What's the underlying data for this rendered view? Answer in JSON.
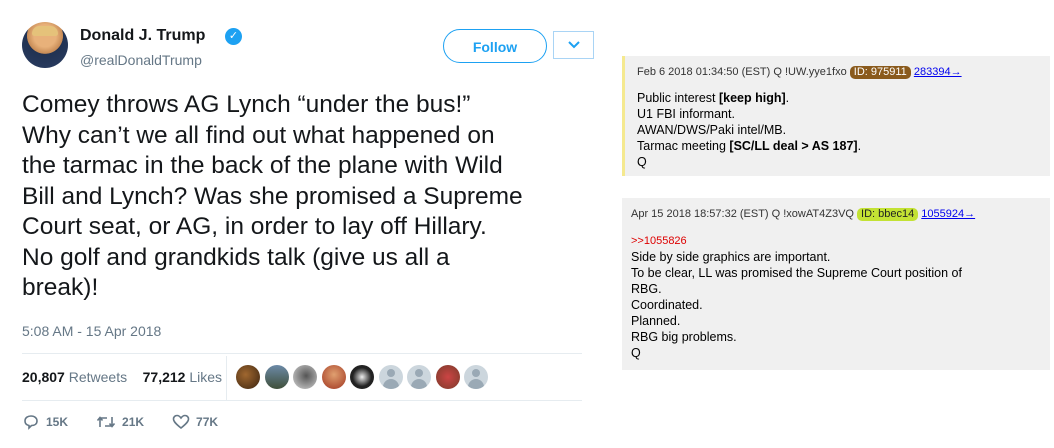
{
  "tweet": {
    "display_name": "Donald J. Trump",
    "handle": "@realDonaldTrump",
    "follow_label": "Follow",
    "text_lines": [
      "Comey throws AG Lynch “under the bus!”",
      "Why can’t we all find out what happened on",
      "the tarmac in the back of the plane with Wild",
      "Bill and Lynch? Was she promised a Supreme",
      "Court seat, or AG, in order to lay off Hillary.",
      "No golf and grandkids talk (give us all a",
      "break)!"
    ],
    "timestamp": "5:08 AM - 15 Apr 2018",
    "retweets_count": "20,807",
    "retweets_label": "Retweets",
    "likes_count": "77,212",
    "likes_label": "Likes",
    "reply_count": "15K",
    "retweet_action_count": "21K",
    "like_action_count": "77K",
    "colors": {
      "accent": "#1da1f2",
      "text": "#14171a",
      "muted": "#657786"
    }
  },
  "qposts": [
    {
      "header": "Feb 6 2018 01:34:50 (EST) Q !UW.yye1fxo",
      "id_label": "ID: 975911",
      "link": "283394→",
      "lines": [
        {
          "text": "Public interest ",
          "bold": "[keep high]",
          "tail": "."
        },
        {
          "text": "U1 FBI informant.",
          "bold": "",
          "tail": ""
        },
        {
          "text": "AWAN/DWS/Paki intel/MB.",
          "bold": "",
          "tail": ""
        },
        {
          "text": "Tarmac meeting ",
          "bold": "[SC/LL deal > AS 187]",
          "tail": "."
        },
        {
          "text": "Q",
          "bold": "",
          "tail": ""
        }
      ]
    },
    {
      "header": "Apr 15 2018 18:57:32 (EST) Q !xowAT4Z3VQ",
      "id_label": "ID: bbec14",
      "link": "1055924→",
      "reply_ref": ">>1055826",
      "lines": [
        "Side by side graphics are important.",
        "To be clear, LL was promised the Supreme Court position of",
        "RBG.",
        "Coordinated.",
        "Planned.",
        "RBG big problems.",
        "Q"
      ]
    }
  ]
}
